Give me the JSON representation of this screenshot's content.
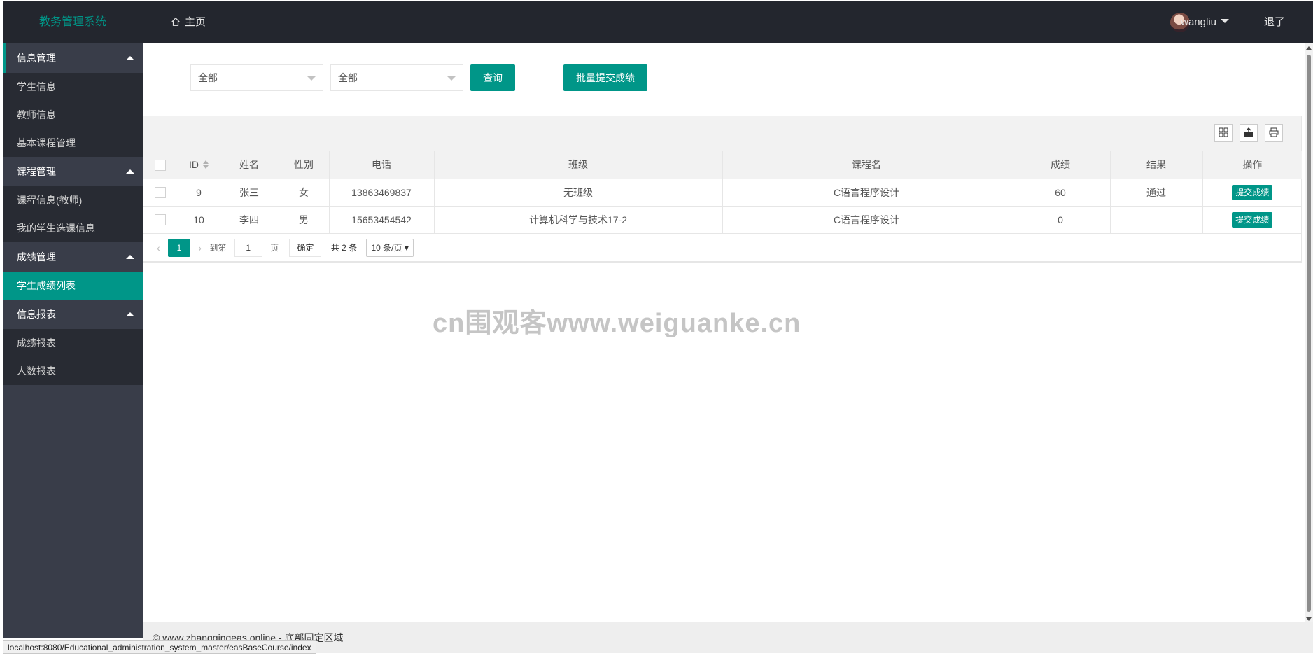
{
  "header": {
    "logo": "教务管理系统",
    "home": "主页",
    "username": "wangliu",
    "logout": "退了"
  },
  "sidebar": {
    "groups": [
      {
        "label": "信息管理",
        "items": [
          "学生信息",
          "教师信息",
          "基本课程管理"
        ]
      },
      {
        "label": "课程管理",
        "items": [
          "课程信息(教师)",
          "我的学生选课信息"
        ]
      },
      {
        "label": "成绩管理",
        "items": [
          "学生成绩列表"
        ]
      },
      {
        "label": "信息报表",
        "items": [
          "成绩报表",
          "人数报表"
        ]
      }
    ],
    "active_item": "学生成绩列表"
  },
  "filters": {
    "select1_value": "全部",
    "select2_value": "全部",
    "query_label": "查询",
    "batch_label": "批量提交成绩"
  },
  "table": {
    "columns": [
      "ID",
      "姓名",
      "性别",
      "电话",
      "班级",
      "课程名",
      "成绩",
      "结果",
      "操作"
    ],
    "rows": [
      {
        "id": "9",
        "name": "张三",
        "gender": "女",
        "phone": "13863469837",
        "class": "无班级",
        "course": "C语言程序设计",
        "score": "60",
        "result": "通过",
        "action": "提交成绩"
      },
      {
        "id": "10",
        "name": "李四",
        "gender": "男",
        "phone": "15653454542",
        "class": "计算机科学与技术17-2",
        "course": "C语言程序设计",
        "score": "0",
        "result": "",
        "action": "提交成绩"
      }
    ]
  },
  "pager": {
    "current": "1",
    "goto_label": "到第",
    "page_value": "1",
    "page_unit": "页",
    "confirm": "确定",
    "total": "共 2 条",
    "page_size": "10 条/页"
  },
  "watermark": "cn围观客www.weiguanke.cn",
  "footer": "© www.zhangqingeas.online - 底部固定区域",
  "statusbar": "localhost:8080/Educational_administration_system_master/easBaseCourse/index",
  "colors": {
    "accent": "#009688",
    "header_bg": "#23262e",
    "sidebar_bg": "#393d49"
  }
}
